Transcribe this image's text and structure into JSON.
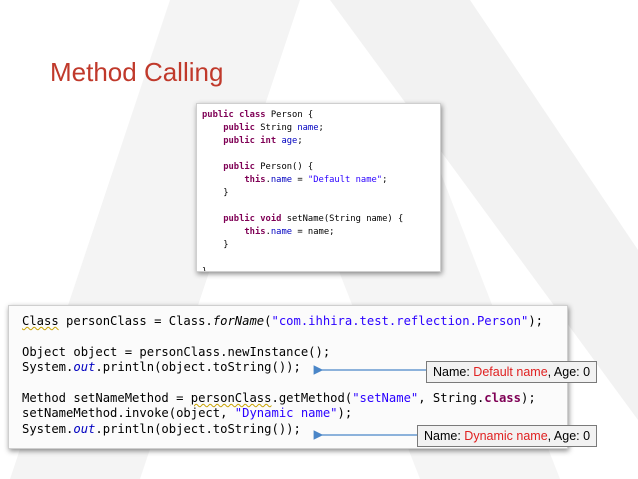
{
  "slide": {
    "title": "Method Calling"
  },
  "code_person": {
    "l1_kw": "public class",
    "l1_rest": " Person {",
    "l2_kw": "public",
    "l2_rest": " String ",
    "l2_fld": "name",
    "l2_end": ";",
    "l3_kw": "public int",
    "l3_fld": "age",
    "l3_end": ";",
    "l5_kw": "public",
    "l5_rest": " Person() {",
    "l6_kw": "this",
    "l6_dot": ".",
    "l6_fld": "name",
    "l6_eq": " = ",
    "l6_str": "\"Default name\"",
    "l6_end": ";",
    "l7": "}",
    "l9_kw": "public void",
    "l9_rest": " setName(String name) {",
    "l10_kw": "this",
    "l10_dot": ".",
    "l10_fld": "name",
    "l10_rest": " = name;",
    "l11": "}",
    "l13": "}"
  },
  "code_reflection": {
    "a1": "Class",
    "a2": " personClass = Class.",
    "a3": "forName",
    "a4": "(",
    "a5": "\"com.ihhira.test.reflection.Person\"",
    "a6": ");",
    "b1": "Object object = personClass.newInstance();",
    "c1": "System.",
    "c2": "out",
    "c3": ".println(object.toString());",
    "d1": "Method setNameMethod = ",
    "d2": "personClass",
    "d3": ".getMethod(",
    "d4": "\"setName\"",
    "d5": ", String.",
    "d6": "class",
    "d7": ");",
    "e1": "setNameMethod.invoke(object, ",
    "e2": "\"Dynamic name\"",
    "e3": ");",
    "f1": "System.",
    "f2": "out",
    "f3": ".println(object.toString());"
  },
  "outputs": [
    {
      "prefix": "Name: ",
      "value": "Default name",
      "suffix": ", Age: 0"
    },
    {
      "prefix": "Name: ",
      "value": "Dynamic name",
      "suffix": ", Age: 0"
    }
  ],
  "colors": {
    "title": "#c0392b",
    "keyword": "#7f0055",
    "field": "#0000c0",
    "string": "#2a00ff",
    "highlight_value": "#e02020",
    "arrow": "#4a86c8"
  }
}
